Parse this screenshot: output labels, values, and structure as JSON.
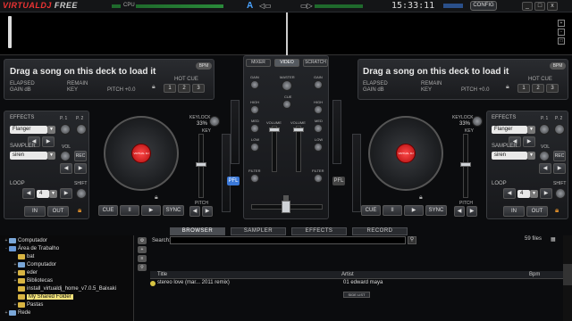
{
  "app": {
    "name_part1": "VIRTUAL",
    "name_part2": "DJ",
    "name_part3": " FREE"
  },
  "topbar": {
    "cpu_label": "CPU",
    "clock": "15:33:11",
    "config_label": "CONFIG",
    "minimize": "_",
    "maximize": "□",
    "close": "x"
  },
  "waveform_controls": [
    "+",
    "-",
    "□"
  ],
  "deck_left": {
    "title": "Drag a song on this deck to load it",
    "elapsed": "ELAPSED",
    "remain": "REMAIN",
    "gain": "GAIN dB",
    "key": "KEY",
    "pitch": "PITCH +0.0",
    "bpm_badge": "BPM",
    "hot_cue_label": "HOT CUE",
    "hot_cues": [
      "1",
      "2",
      "3"
    ],
    "effects_label": "EFFECTS",
    "effect_value": "Flanger",
    "p1": "P. 1",
    "p2": "P. 2",
    "sampler_label": "SAMPLER",
    "sampler_value": "siren",
    "vol": "VOL",
    "rec": "REC",
    "loop_label": "LOOP",
    "loop_value": "4",
    "shift": "SHIFT",
    "in": "IN",
    "out": "OUT",
    "keylock": "KEYLOCK",
    "keylock_value": "33%",
    "key_label": "KEY",
    "pitch_label": "PITCH",
    "cue": "CUE",
    "pause": "II",
    "play": "▶",
    "sync": "SYNC",
    "platter_label": "VIRTUAL DJ"
  },
  "deck_right": {
    "title": "Drag a song on this deck to load it",
    "elapsed": "ELAPSED",
    "remain": "REMAIN",
    "gain": "GAIN dB",
    "key": "KEY",
    "pitch": "PITCH +0.0",
    "bpm_badge": "BPM",
    "hot_cue_label": "HOT CUE",
    "hot_cues": [
      "1",
      "2",
      "3"
    ],
    "effects_label": "EFFECTS",
    "effect_value": "Flanger",
    "p1": "P. 1",
    "p2": "P. 2",
    "sampler_label": "SAMPLER",
    "sampler_value": "siren",
    "vol": "VOL",
    "rec": "REC",
    "loop_label": "LOOP",
    "loop_value": "4",
    "shift": "SHIFT",
    "in": "IN",
    "out": "OUT",
    "keylock": "KEYLOCK",
    "keylock_value": "33%",
    "key_label": "KEY",
    "pitch_label": "PITCH",
    "cue": "CUE",
    "pause": "II",
    "play": "▶",
    "sync": "SYNC",
    "platter_label": "VIRTUAL DJ"
  },
  "mixer": {
    "tabs": [
      "MIXER",
      "VIDEO",
      "SCRATCH"
    ],
    "active_tab": "VIDEO",
    "gain": "GAIN",
    "master": "MASTER",
    "cue": "CUE",
    "high": "HIGH",
    "med": "MED",
    "low": "LOW",
    "volume": "VOLUME",
    "filter": "FILTER",
    "pfl": "PFL"
  },
  "browser_tabs": [
    "BROWSER",
    "SAMPLER",
    "EFFECTS",
    "RECORD"
  ],
  "active_browser_tab": "BROWSER",
  "tree": [
    {
      "label": "Computador",
      "level": 0,
      "expander": "+"
    },
    {
      "label": "Área de Trabalho",
      "level": 0,
      "expander": "-"
    },
    {
      "label": "bat",
      "level": 1,
      "expander": ""
    },
    {
      "label": "Computador",
      "level": 1,
      "expander": "+"
    },
    {
      "label": "eder",
      "level": 1,
      "expander": "+"
    },
    {
      "label": "Bibliotecas",
      "level": 1,
      "expander": "+"
    },
    {
      "label": "install_virtualdj_home_v7.0.5_Baixaki",
      "level": 1,
      "expander": ""
    },
    {
      "label": "My Shared Folder",
      "level": 1,
      "expander": "",
      "selected": true
    },
    {
      "label": "Pastas",
      "level": 1,
      "expander": "+"
    },
    {
      "label": "Rede",
      "level": 0,
      "expander": "+"
    }
  ],
  "search": {
    "label": "Search:",
    "files_count": "59 files"
  },
  "table": {
    "columns": [
      "Title",
      "Artist",
      "Bpm"
    ],
    "rows": [
      {
        "title": "stereo love (mar... 2011 remix)",
        "artist": "01 edward maya",
        "bpm": ""
      }
    ]
  },
  "side_list": "SIDE LIST",
  "colors": {
    "accent_red": "#e02a2a",
    "pfl_blue": "#3a78d8",
    "selection_yellow": "#f1e17a"
  }
}
